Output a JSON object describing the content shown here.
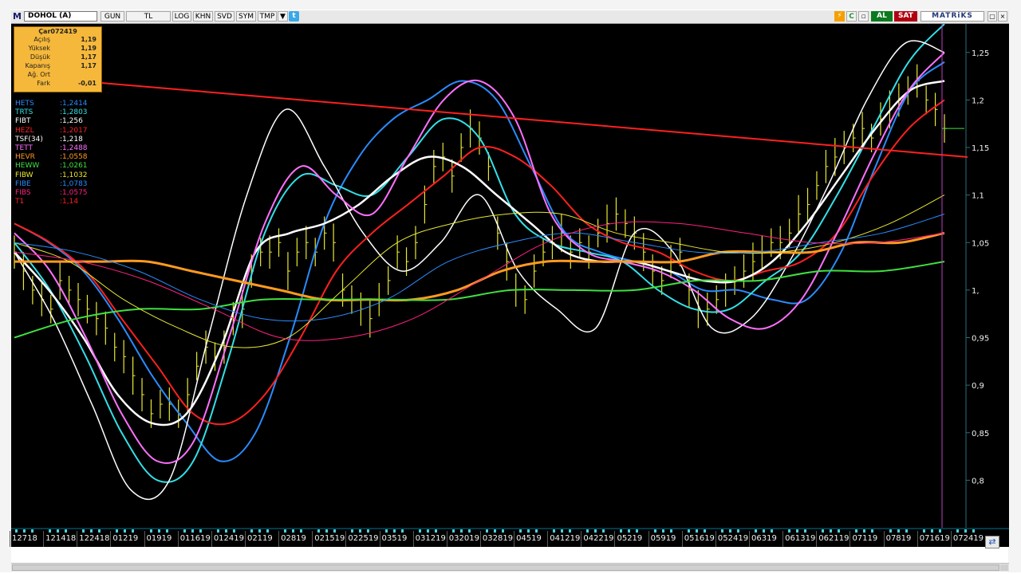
{
  "toolbar": {
    "logo": "M",
    "symbol": "DOHOL (A)",
    "buttons": [
      "GUN",
      "TL",
      "LOG",
      "KHN",
      "SVD",
      "SYM",
      "TMP"
    ],
    "dropdown_glyph": "▼",
    "twitter_glyph": "t",
    "al_label": "AL",
    "sat_label": "SAT",
    "brand": "MATRiKS",
    "win_buttons": [
      "▢",
      "×"
    ]
  },
  "infobox": {
    "title": "Çar072419",
    "rows": [
      {
        "label": "Açılış",
        "value": "1,19"
      },
      {
        "label": "Yüksek",
        "value": "1,19"
      },
      {
        "label": "Düşük",
        "value": "1,17"
      },
      {
        "label": "Kapanış",
        "value": "1,17"
      },
      {
        "label": "Ağ. Ort",
        "value": ""
      },
      {
        "label": "Fark",
        "value": "-0,01"
      }
    ]
  },
  "legend": [
    {
      "name": "HETS",
      "value": ":1,2414",
      "color": "#2a8cff"
    },
    {
      "name": "TRTS",
      "value": ":1,2803",
      "color": "#33e0e8"
    },
    {
      "name": "FIBT",
      "value": ":1,256",
      "color": "#ffffff"
    },
    {
      "name": "HEZL",
      "value": ":1,2017",
      "color": "#ff2020"
    },
    {
      "name": "TSF(34)",
      "value": ":1,218",
      "color": "#ffffff"
    },
    {
      "name": "TETT",
      "value": ":1,2488",
      "color": "#ff70ff"
    },
    {
      "name": "HEVR",
      "value": ":1,0558",
      "color": "#ff9a20"
    },
    {
      "name": "HEWW",
      "value": ":1,0261",
      "color": "#40e040"
    },
    {
      "name": "FIBW",
      "value": ":1,1032",
      "color": "#e8e830"
    },
    {
      "name": "FIBE",
      "value": ":1,0783",
      "color": "#2a8cff"
    },
    {
      "name": "FIBS",
      "value": ":1,0575",
      "color": "#ff2080"
    },
    {
      "name": "T1",
      "value": ":1,14",
      "color": "#ff2020"
    }
  ],
  "chart_data": {
    "type": "line",
    "symbol": "DOHOL (A)",
    "y_axis_side": "right",
    "yticks": [
      "1,25",
      "1,2",
      "1,15",
      "1,1",
      "1,05",
      "1,",
      "0,95",
      "0,9",
      "0,85",
      "0,8"
    ],
    "ytick_values": [
      1.25,
      1.2,
      1.15,
      1.1,
      1.05,
      1.0,
      0.95,
      0.9,
      0.85,
      0.8
    ],
    "ylim": [
      0.75,
      1.28
    ],
    "xticks": [
      "12718",
      "121418",
      "122418",
      "01219",
      "01919",
      "011619",
      "012419",
      "02119",
      "02819",
      "021519",
      "022519",
      "03519",
      "031219",
      "032019",
      "032819",
      "04519",
      "041219",
      "042219",
      "05219",
      "05919",
      "051619",
      "052419",
      "06319",
      "061319",
      "062119",
      "07119",
      "07819",
      "071619",
      "072419"
    ],
    "price_bars": {
      "color": "#e8e830",
      "close": [
        1.04,
        1.02,
        1.0,
        0.99,
        0.98,
        1.01,
        1.0,
        0.99,
        0.98,
        0.97,
        0.96,
        0.94,
        0.93,
        0.91,
        0.89,
        0.87,
        0.88,
        0.88,
        0.87,
        0.89,
        0.92,
        0.94,
        0.93,
        0.94,
        0.97,
        0.98,
        1.02,
        1.04,
        1.04,
        1.05,
        1.02,
        1.04,
        1.05,
        1.04,
        1.06,
        1.05,
        1.0,
        0.99,
        0.98,
        0.97,
        0.99,
        1.01,
        1.04,
        1.03,
        1.05,
        1.09,
        1.13,
        1.14,
        1.12,
        1.15,
        1.17,
        1.16,
        1.13,
        1.06,
        1.03,
        1.0,
        0.99,
        1.02,
        1.04,
        1.05,
        1.06,
        1.04,
        1.05,
        1.04,
        1.06,
        1.07,
        1.08,
        1.07,
        1.06,
        1.04,
        1.02,
        1.01,
        1.03,
        1.04,
        1.0,
        0.98,
        0.98,
        0.99,
        1.0,
        1.01,
        1.02,
        1.03,
        1.04,
        1.05,
        1.05,
        1.06,
        1.08,
        1.09,
        1.11,
        1.13,
        1.14,
        1.15,
        1.16,
        1.17,
        1.16,
        1.18,
        1.19,
        1.2,
        1.21,
        1.22,
        1.2,
        1.19,
        1.17
      ],
      "ranges": [
        0.035,
        0.04,
        0.03,
        0.035,
        0.03,
        0.04,
        0.03,
        0.035,
        0.03,
        0.035,
        0.035,
        0.03,
        0.035,
        0.04,
        0.035,
        0.03,
        0.03,
        0.035,
        0.03,
        0.035,
        0.03,
        0.035,
        0.03,
        0.035,
        0.035,
        0.04,
        0.035,
        0.03,
        0.035,
        0.03,
        0.04,
        0.03,
        0.035,
        0.03,
        0.035,
        0.04,
        0.035,
        0.03,
        0.035,
        0.04,
        0.035,
        0.03,
        0.035,
        0.03,
        0.035,
        0.04,
        0.035,
        0.03,
        0.035,
        0.03,
        0.04,
        0.035,
        0.03,
        0.035,
        0.04,
        0.035,
        0.03,
        0.035,
        0.03,
        0.035,
        0.04,
        0.035,
        0.03,
        0.035,
        0.03,
        0.04,
        0.035,
        0.03,
        0.035,
        0.04,
        0.035,
        0.03,
        0.035,
        0.03,
        0.035,
        0.04,
        0.035,
        0.03,
        0.035,
        0.03,
        0.035,
        0.04,
        0.035,
        0.03,
        0.035,
        0.03,
        0.04,
        0.035,
        0.03,
        0.035,
        0.04,
        0.035,
        0.03,
        0.035,
        0.03,
        0.035,
        0.04,
        0.035,
        0.03,
        0.035,
        0.03,
        0.035,
        0.03
      ]
    },
    "series": [
      {
        "name": "HETS",
        "color": "#2a8cff",
        "width": 2,
        "values": [
          1.07,
          1.05,
          1.02,
          0.97,
          0.91,
          0.86,
          0.82,
          0.85,
          0.95,
          1.07,
          1.14,
          1.18,
          1.2,
          1.22,
          1.2,
          1.13,
          1.06,
          1.04,
          1.03,
          1.02,
          1.0,
          1.0,
          0.99,
          0.99,
          1.04,
          1.13,
          1.21,
          1.24
        ]
      },
      {
        "name": "TRTS",
        "color": "#33e0e8",
        "width": 2,
        "values": [
          1.05,
          1.0,
          0.93,
          0.85,
          0.8,
          0.82,
          0.93,
          1.06,
          1.12,
          1.11,
          1.1,
          1.14,
          1.18,
          1.16,
          1.08,
          1.05,
          1.04,
          1.03,
          1.0,
          0.98,
          0.98,
          1.01,
          1.04,
          1.1,
          1.17,
          1.24,
          1.28
        ]
      },
      {
        "name": "FIBT",
        "color": "#ffffff",
        "width": 1.5,
        "values": [
          1.04,
          0.97,
          0.88,
          0.79,
          0.8,
          0.95,
          1.1,
          1.19,
          1.13,
          1.06,
          1.02,
          1.05,
          1.1,
          1.02,
          0.98,
          0.96,
          1.06,
          1.04,
          0.96,
          0.97,
          1.03,
          1.11,
          1.2,
          1.26,
          1.25
        ]
      },
      {
        "name": "HEZL",
        "color": "#ff2020",
        "width": 2,
        "values": [
          1.07,
          1.05,
          1.02,
          0.97,
          0.92,
          0.87,
          0.86,
          0.89,
          0.95,
          1.02,
          1.06,
          1.09,
          1.12,
          1.15,
          1.14,
          1.11,
          1.07,
          1.05,
          1.04,
          1.02,
          1.01,
          1.02,
          1.03,
          1.06,
          1.12,
          1.17,
          1.2
        ]
      },
      {
        "name": "TSF(34)",
        "color": "#ffffff",
        "width": 2.5,
        "values": [
          1.04,
          1.0,
          0.95,
          0.89,
          0.86,
          0.87,
          0.94,
          1.04,
          1.06,
          1.07,
          1.09,
          1.12,
          1.14,
          1.13,
          1.1,
          1.07,
          1.04,
          1.03,
          1.03,
          1.02,
          1.01,
          1.01,
          1.03,
          1.07,
          1.12,
          1.17,
          1.21,
          1.22
        ]
      },
      {
        "name": "TETT",
        "color": "#ff70ff",
        "width": 2,
        "values": [
          1.06,
          1.02,
          0.95,
          0.87,
          0.82,
          0.84,
          0.95,
          1.07,
          1.13,
          1.1,
          1.08,
          1.14,
          1.2,
          1.22,
          1.18,
          1.08,
          1.04,
          1.03,
          1.02,
          1.0,
          0.97,
          0.96,
          0.99,
          1.06,
          1.14,
          1.21,
          1.25
        ]
      },
      {
        "name": "HEVR",
        "color": "#ff9a20",
        "width": 3,
        "values": [
          1.03,
          1.03,
          1.03,
          1.03,
          1.02,
          1.01,
          1.0,
          0.99,
          0.99,
          0.99,
          1.0,
          1.02,
          1.03,
          1.03,
          1.03,
          1.03,
          1.04,
          1.04,
          1.04,
          1.05,
          1.05,
          1.06
        ]
      },
      {
        "name": "HEWW",
        "color": "#40e040",
        "width": 2,
        "values": [
          0.95,
          0.97,
          0.98,
          0.98,
          0.99,
          0.99,
          0.99,
          0.99,
          1.0,
          1.0,
          1.0,
          1.01,
          1.01,
          1.02,
          1.02,
          1.03
        ]
      },
      {
        "name": "FIBW",
        "color": "#e8e830",
        "width": 1,
        "values": [
          1.05,
          1.03,
          0.99,
          0.96,
          0.94,
          0.95,
          1.0,
          1.05,
          1.07,
          1.08,
          1.08,
          1.06,
          1.05,
          1.04,
          1.04,
          1.05,
          1.07,
          1.1
        ]
      },
      {
        "name": "FIBE",
        "color": "#2a8cff",
        "width": 1,
        "values": [
          1.05,
          1.04,
          1.02,
          0.99,
          0.97,
          0.97,
          0.99,
          1.03,
          1.05,
          1.06,
          1.05,
          1.04,
          1.04,
          1.05,
          1.06,
          1.08
        ]
      },
      {
        "name": "FIBS",
        "color": "#ff2080",
        "width": 1,
        "values": [
          1.04,
          1.03,
          1.01,
          0.98,
          0.95,
          0.95,
          0.97,
          1.01,
          1.05,
          1.07,
          1.07,
          1.06,
          1.05,
          1.05,
          1.06
        ]
      },
      {
        "name": "T1",
        "color": "#ff2020",
        "width": 2,
        "values": [
          1.22,
          1.14
        ]
      }
    ],
    "last_close": 1.17,
    "last_close_color": "#40e040",
    "cursor_line_color": "#c040c0"
  }
}
